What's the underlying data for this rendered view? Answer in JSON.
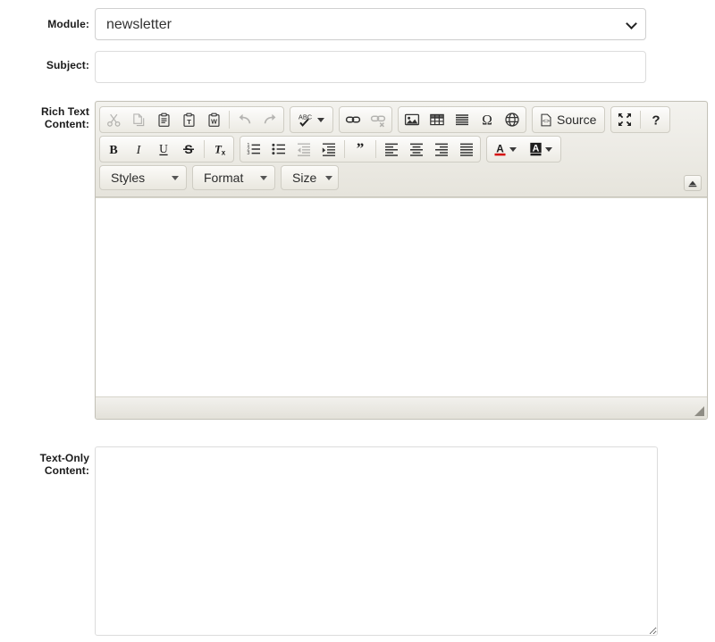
{
  "form": {
    "module": {
      "label": "Module:",
      "value": "newsletter",
      "options": [
        "newsletter"
      ]
    },
    "subject": {
      "label": "Subject:",
      "value": "",
      "placeholder": ""
    },
    "rich_text": {
      "label": "Rich Text\nContent:",
      "label_line1": "Rich Text",
      "label_line2": "Content:",
      "value": ""
    },
    "text_only": {
      "label_line1": "Text-Only",
      "label_line2": "Content:",
      "value": "",
      "placeholder": ""
    }
  },
  "editor": {
    "toolbar_rows": [
      {
        "groups": [
          {
            "name": "clipboard",
            "buttons": [
              {
                "name": "cut-icon",
                "title": "Cut",
                "disabled": true
              },
              {
                "name": "copy-icon",
                "title": "Copy",
                "disabled": true
              },
              {
                "name": "paste-icon",
                "title": "Paste",
                "disabled": false
              },
              {
                "name": "paste-text-icon",
                "title": "Paste as plain text",
                "disabled": false
              },
              {
                "name": "paste-word-icon",
                "title": "Paste from Word",
                "disabled": false
              },
              {
                "name": "separator",
                "title": "",
                "disabled": false
              },
              {
                "name": "undo-icon",
                "title": "Undo",
                "disabled": true
              },
              {
                "name": "redo-icon",
                "title": "Redo",
                "disabled": true
              }
            ]
          },
          {
            "name": "spellcheck",
            "buttons": [
              {
                "name": "spellcheck-icon",
                "title": "Spell Check As You Type",
                "disabled": false
              }
            ]
          },
          {
            "name": "links",
            "buttons": [
              {
                "name": "link-icon",
                "title": "Link",
                "disabled": false
              },
              {
                "name": "unlink-icon",
                "title": "Unlink",
                "disabled": true
              }
            ]
          },
          {
            "name": "insert",
            "buttons": [
              {
                "name": "image-icon",
                "title": "Image",
                "disabled": false
              },
              {
                "name": "table-icon",
                "title": "Table",
                "disabled": false
              },
              {
                "name": "horizontal-rule-icon",
                "title": "Horizontal Line",
                "disabled": false
              },
              {
                "name": "special-char-icon",
                "title": "Insert Special Character",
                "disabled": false
              },
              {
                "name": "iframe-icon",
                "title": "IFrame",
                "disabled": false
              }
            ]
          },
          {
            "name": "document",
            "buttons": [
              {
                "name": "source-icon",
                "title": "Source",
                "label": "Source",
                "disabled": false
              }
            ]
          },
          {
            "name": "tools",
            "buttons": [
              {
                "name": "maximize-icon",
                "title": "Maximize",
                "disabled": false
              },
              {
                "name": "about-icon",
                "title": "About CKEditor",
                "disabled": false
              }
            ]
          }
        ]
      },
      {
        "groups": [
          {
            "name": "basicstyles",
            "buttons": [
              {
                "name": "bold-icon",
                "title": "Bold",
                "glyph": "B",
                "disabled": false
              },
              {
                "name": "italic-icon",
                "title": "Italic",
                "glyph": "I",
                "disabled": false
              },
              {
                "name": "underline-icon",
                "title": "Underline",
                "glyph": "U",
                "disabled": false
              },
              {
                "name": "strikethrough-icon",
                "title": "Strike Through",
                "glyph": "S",
                "disabled": false
              },
              {
                "name": "remove-format-icon",
                "title": "Remove Format",
                "glyph": "Tx",
                "disabled": false
              }
            ]
          },
          {
            "name": "paragraph",
            "buttons": [
              {
                "name": "numbered-list-icon",
                "title": "Insert/Remove Numbered List",
                "disabled": false
              },
              {
                "name": "bulleted-list-icon",
                "title": "Insert/Remove Bulleted List",
                "disabled": false
              },
              {
                "name": "outdent-icon",
                "title": "Decrease Indent",
                "disabled": true
              },
              {
                "name": "indent-icon",
                "title": "Increase Indent",
                "disabled": false
              },
              {
                "name": "separator",
                "title": "",
                "disabled": false
              },
              {
                "name": "blockquote-icon",
                "title": "Block Quote",
                "disabled": false
              },
              {
                "name": "separator",
                "title": "",
                "disabled": false
              },
              {
                "name": "align-left-icon",
                "title": "Align Left",
                "disabled": false
              },
              {
                "name": "align-center-icon",
                "title": "Center",
                "disabled": false
              },
              {
                "name": "align-right-icon",
                "title": "Align Right",
                "disabled": false
              },
              {
                "name": "align-justify-icon",
                "title": "Justify",
                "disabled": false
              }
            ]
          },
          {
            "name": "colors",
            "buttons": [
              {
                "name": "text-color-icon",
                "title": "Text Color",
                "glyph": "A",
                "disabled": false
              },
              {
                "name": "background-color-icon",
                "title": "Background Color",
                "glyph": "A",
                "disabled": false
              }
            ]
          }
        ]
      },
      {
        "groups": [
          {
            "name": "styles-combo",
            "label": "Styles"
          },
          {
            "name": "format-combo",
            "label": "Format"
          },
          {
            "name": "size-combo",
            "label": "Size"
          }
        ]
      }
    ],
    "collapse_button": {
      "name": "collapse-toolbar-icon",
      "title": "Collapse Toolbar"
    },
    "resize_handle": {
      "name": "editor-resize-handle",
      "title": "Resize"
    },
    "source_label": "Source",
    "combos": {
      "styles": "Styles",
      "format": "Format",
      "size": "Size"
    }
  },
  "colors": {
    "toolbar_bg": "#ebeae4",
    "toolbar_border": "#c4c2b8",
    "editing_area_bg": "#ffffff",
    "label_text": "#1a1a1a",
    "text_color_accent": "#d40000",
    "input_border": "#dcdcdc"
  }
}
